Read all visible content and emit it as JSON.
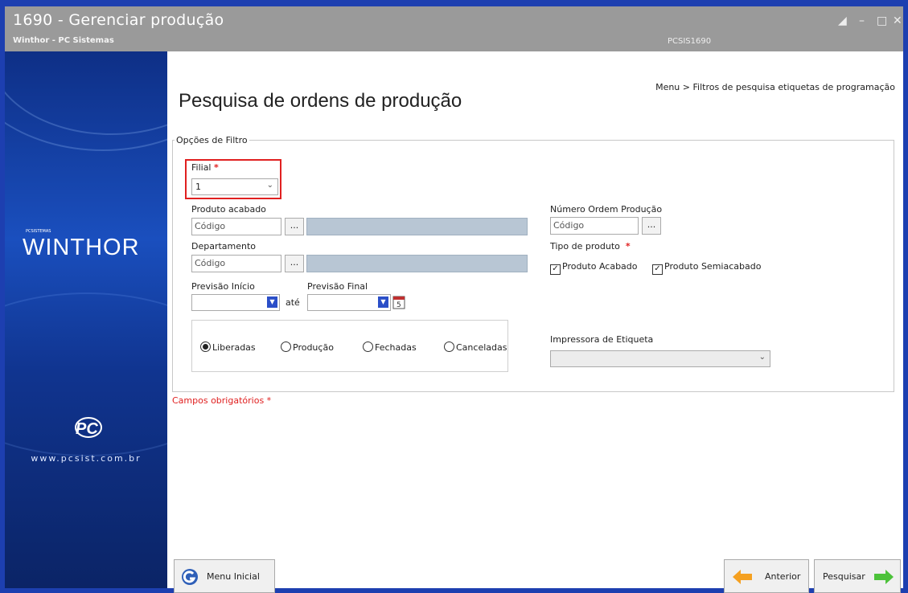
{
  "window": {
    "title": "1690 - Gerenciar produção",
    "subtitle": "Winthor - PC Sistemas",
    "code": "PCSIS1690",
    "controls": [
      "restore-icon",
      "minimize-icon",
      "maximize-icon",
      "close-icon"
    ]
  },
  "sidebar": {
    "brand_small": "PCSISTEMAS",
    "brand": "WINTHOR",
    "logo_text": "PC",
    "site": "www.pcsist.com.br"
  },
  "header": {
    "breadcrumb": "Menu > Filtros de pesquisa etiquetas de programação",
    "title": "Pesquisa de ordens de produção"
  },
  "filters": {
    "legend": "Opções de Filtro",
    "filial": {
      "label": "Filial",
      "required_mark": "*",
      "value": "1"
    },
    "produto_acabado": {
      "label": "Produto acabado",
      "placeholder": "Código",
      "button": "..."
    },
    "departamento": {
      "label": "Departamento",
      "placeholder": "Código",
      "button": "..."
    },
    "numero_ordem": {
      "label": "Número Ordem Produção",
      "placeholder": "Código",
      "button": "..."
    },
    "tipo_produto": {
      "label": "Tipo de produto",
      "required_mark": "*",
      "options": [
        {
          "label": "Produto Acabado",
          "checked": true
        },
        {
          "label": "Produto Semiacabado",
          "checked": true
        }
      ]
    },
    "previsao_inicio": {
      "label": "Previsão Início",
      "value": ""
    },
    "ate": "até",
    "previsao_final": {
      "label": "Previsão Final",
      "value": ""
    },
    "status": {
      "options": [
        {
          "label": "Liberadas",
          "selected": true
        },
        {
          "label": "Produção",
          "selected": false
        },
        {
          "label": "Fechadas",
          "selected": false
        },
        {
          "label": "Canceladas",
          "selected": false
        }
      ]
    },
    "impressora": {
      "label": "Impressora de Etiqueta",
      "value": ""
    }
  },
  "required_note": "Campos obrigatórios *",
  "footer": {
    "menu_inicial": "Menu Inicial",
    "anterior": "Anterior",
    "pesquisar": "Pesquisar"
  },
  "colors": {
    "accent_required": "#e02020",
    "frame_blue": "#1d3fb0",
    "titlebar_gray": "#9a9a9a",
    "arrow_orange": "#f5a020",
    "arrow_green": "#4cc23a"
  }
}
